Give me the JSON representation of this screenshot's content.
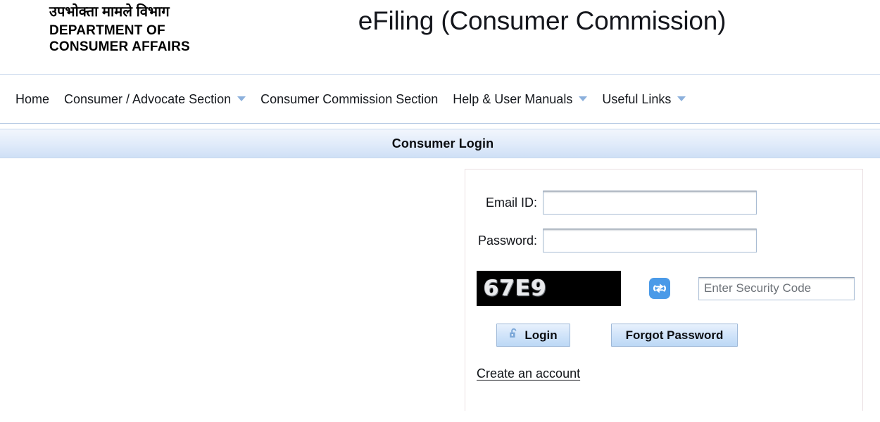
{
  "header": {
    "brand_hindi": "उपभोक्ता मामले विभाग",
    "brand_line1": "DEPARTMENT OF",
    "brand_line2": "CONSUMER AFFAIRS",
    "app_title": "eFiling (Consumer Commission)"
  },
  "nav": {
    "items": [
      {
        "label": "Home",
        "has_caret": false
      },
      {
        "label": "Consumer / Advocate Section",
        "has_caret": true
      },
      {
        "label": "Consumer Commission Section",
        "has_caret": false
      },
      {
        "label": "Help & User Manuals",
        "has_caret": true
      },
      {
        "label": "Useful Links",
        "has_caret": true
      }
    ]
  },
  "section_bar": {
    "title": "Consumer Login"
  },
  "login_form": {
    "email_label": "Email ID:",
    "email_value": "",
    "email_placeholder": "",
    "password_label": "Password:",
    "password_value": "",
    "password_placeholder": "",
    "captcha_text": "67E9",
    "refresh_title": "Refresh captcha",
    "security_code_value": "",
    "security_code_placeholder": "Enter Security Code",
    "login_label": "Login",
    "forgot_password_label": "Forgot Password",
    "create_account_label": "Create an account"
  },
  "colors": {
    "accent_blue": "#4a9ae8",
    "caret_blue": "#8cb0dc",
    "bar_gradient_top": "#f2f6fd",
    "bar_gradient_bottom": "#cfe0f6",
    "captcha_bg": "#000000",
    "captcha_fg": "#e9eaec"
  }
}
